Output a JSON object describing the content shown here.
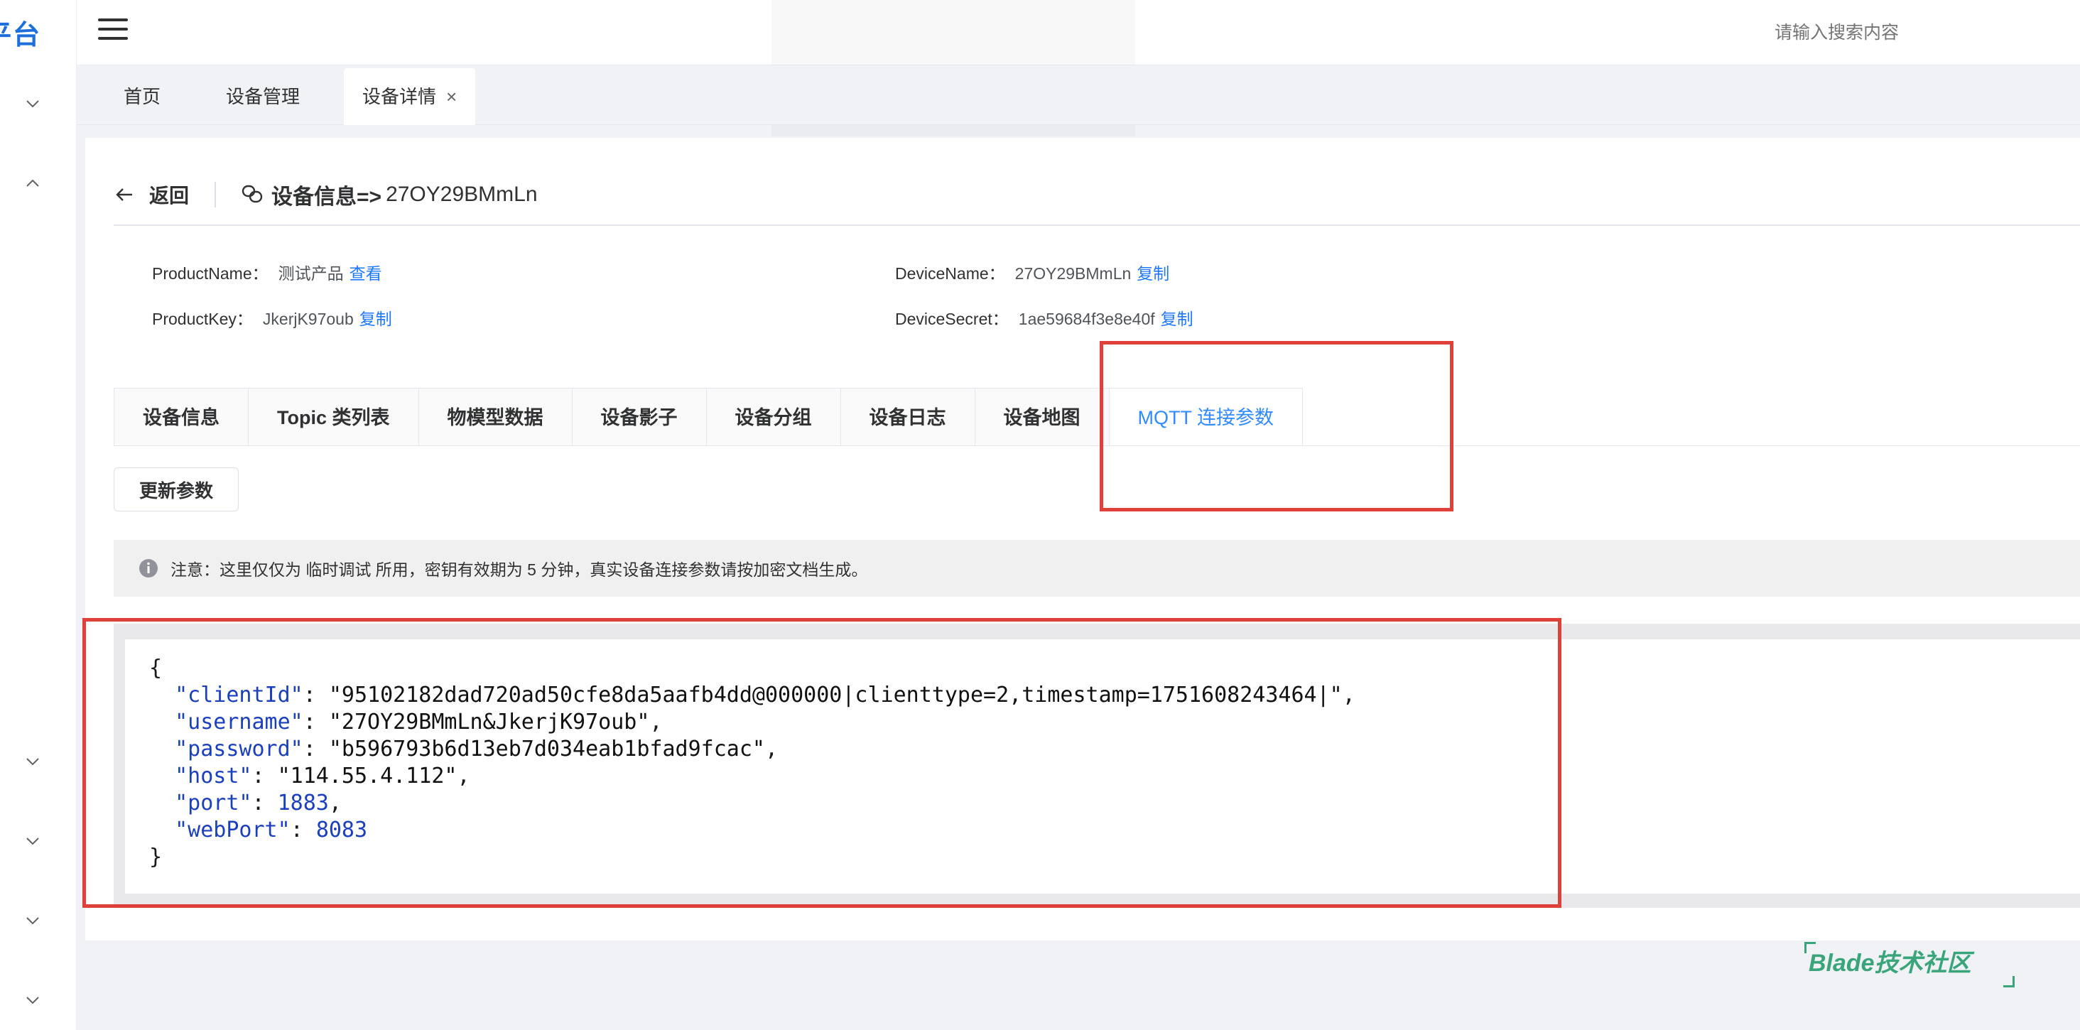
{
  "app": {
    "logo_text": "平台"
  },
  "header": {
    "search_placeholder": "请输入搜索内容"
  },
  "tags": [
    {
      "label": "首页"
    },
    {
      "label": "设备管理"
    },
    {
      "label": "设备详情",
      "close": "×"
    }
  ],
  "page": {
    "back_label": "返回",
    "title_prefix": "设备信息=>",
    "device_id": "27OY29BMmLn"
  },
  "info": {
    "product_name_label": "ProductName：",
    "product_name_value": "测试产品",
    "product_name_link": "查看",
    "device_name_label": "DeviceName：",
    "device_name_value": "27OY29BMmLn",
    "device_name_link": "复制",
    "product_key_label": "ProductKey：",
    "product_key_value": "JkerjK97oub",
    "product_key_link": "复制",
    "device_secret_label": "DeviceSecret：",
    "device_secret_value": "1ae59684f3e8e40f",
    "device_secret_link": "复制"
  },
  "tabs": [
    {
      "label": "设备信息"
    },
    {
      "label": "Topic 类列表"
    },
    {
      "label": "物模型数据"
    },
    {
      "label": "设备影子"
    },
    {
      "label": "设备分组"
    },
    {
      "label": "设备日志"
    },
    {
      "label": "设备地图"
    },
    {
      "label": "MQTT 连接参数",
      "active": true
    }
  ],
  "actions": {
    "update_label": "更新参数"
  },
  "notice": {
    "text": "注意：这里仅仅为 临时调试 所用，密钥有效期为 5 分钟，真实设备连接参数请按加密文档生成。"
  },
  "mqtt": {
    "open_brace": "{",
    "close_brace": "}",
    "clientId_key": "\"clientId\"",
    "clientId_value": "\"95102182dad720ad50cfe8da5aafb4dd@000000|clienttype=2,timestamp=1751608243464|\"",
    "username_key": "\"username\"",
    "username_value": "\"27OY29BMmLn&JkerjK97oub\"",
    "password_key": "\"password\"",
    "password_value": "\"b596793b6d13eb7d034eab1bfad9fcac\"",
    "host_key": "\"host\"",
    "host_value": "\"114.55.4.112\"",
    "port_key": "\"port\"",
    "port_value": "1883",
    "webPort_key": "\"webPort\"",
    "webPort_value": "8083"
  },
  "watermark": {
    "text": "Blade技术社区"
  },
  "colors": {
    "accent": "#2f8bff",
    "highlight_box": "#e0403a",
    "link": "#1e78ff"
  }
}
